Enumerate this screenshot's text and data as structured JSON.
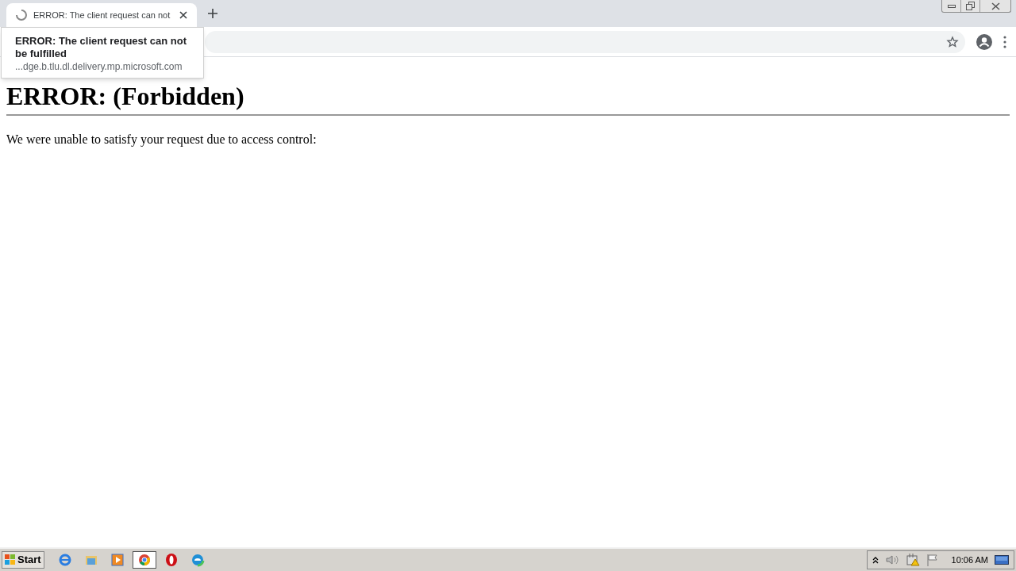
{
  "tabs": [
    {
      "title": "ERROR: The client request can not",
      "selected": true,
      "loading": true
    }
  ],
  "tab_tooltip": {
    "title": "ERROR: The client request can not be fulfilled",
    "url": "...dge.b.tlu.dl.delivery.mp.microsoft.com"
  },
  "page": {
    "heading": "ERROR: (Forbidden)",
    "paragraph": "We were unable to satisfy your request due to access control:"
  },
  "taskbar": {
    "start": "Start",
    "apps": [
      {
        "kind": "ie",
        "selected": false
      },
      {
        "kind": "folder",
        "selected": false
      },
      {
        "kind": "media",
        "selected": false
      },
      {
        "kind": "chrome",
        "selected": true
      },
      {
        "kind": "opera",
        "selected": false
      },
      {
        "kind": "edge",
        "selected": false
      }
    ],
    "clock": "10:06 AM"
  }
}
